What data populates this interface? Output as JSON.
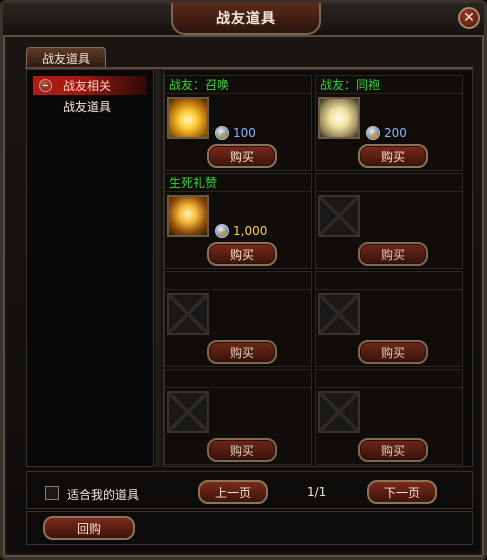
{
  "window": {
    "title": "战友道具"
  },
  "tabs": [
    {
      "label": "战友道具"
    }
  ],
  "sidebar": {
    "items": [
      {
        "label": "战友相关",
        "active": true
      },
      {
        "label": "战友道具",
        "active": false
      }
    ]
  },
  "items": [
    {
      "name": "战友：召唤",
      "price": "100",
      "currency": "silver",
      "icon": "summon-item-icon",
      "buy_label": "购买"
    },
    {
      "name": "战友：同袍",
      "price": "200",
      "currency": "silver",
      "icon": "robe-item-icon",
      "buy_label": "购买"
    },
    {
      "name": "生死礼赞",
      "price": "1,000",
      "currency": "gold",
      "icon": "gift-item-icon",
      "buy_label": "购买"
    },
    {
      "name": "",
      "price": "",
      "buy_label": "购买"
    },
    {
      "name": "",
      "price": "",
      "buy_label": "购买"
    },
    {
      "name": "",
      "price": "",
      "buy_label": "购买"
    },
    {
      "name": "",
      "price": "",
      "buy_label": "购买"
    },
    {
      "name": "",
      "price": "",
      "buy_label": "购买"
    }
  ],
  "footer": {
    "checkbox_label": "适合我的道具",
    "checkbox_checked": false,
    "prev_label": "上一页",
    "next_label": "下一页",
    "page": "1/1",
    "buyback_label": "回购"
  }
}
